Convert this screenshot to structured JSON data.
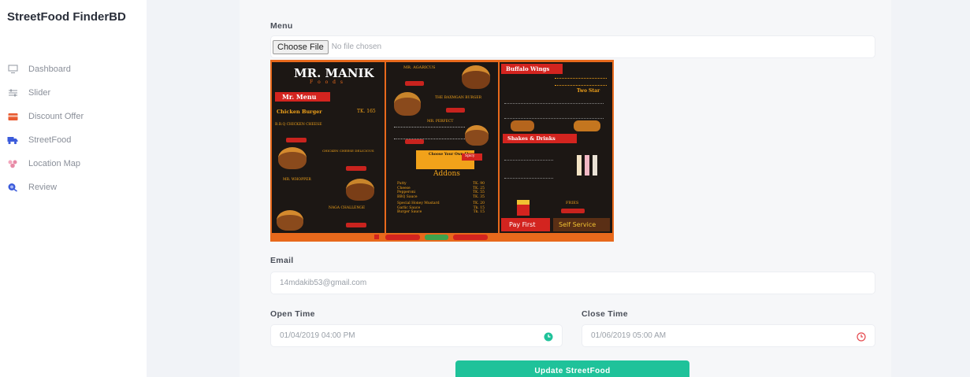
{
  "sidebar": {
    "brand": "StreetFood FinderBD",
    "items": [
      {
        "label": "Dashboard",
        "icon": "monitor-icon",
        "color": "#9aa0a8"
      },
      {
        "label": "Slider",
        "icon": "sliders-icon",
        "color": "#9aa0a8"
      },
      {
        "label": "Discount Offer",
        "icon": "card-icon",
        "color": "#e85a30"
      },
      {
        "label": "StreetFood",
        "icon": "truck-icon",
        "color": "#3b5bdb"
      },
      {
        "label": "Location Map",
        "icon": "map-pins-icon",
        "color": "#e88aa6"
      },
      {
        "label": "Review",
        "icon": "review-icon",
        "color": "#3b5bdb"
      }
    ]
  },
  "form": {
    "menu_label": "Menu",
    "choose_file": "Choose File",
    "no_file": "No file chosen",
    "email_label": "Email",
    "email_value": "14mdakib53@gmail.com",
    "open_time_label": "Open Time",
    "open_time_value": "01/04/2019 04:00 PM",
    "close_time_label": "Close Time",
    "close_time_value": "01/06/2019 05:00 AM",
    "submit_label": "Update StreetFood"
  },
  "menu_image": {
    "title": "MR. MANIK",
    "subtitle": "F o o d s",
    "menu_ribbon": "Mr. Menu",
    "chicken_burger": "Chicken Burger",
    "chicken_burger_price": "TK. 165",
    "bbq": "B.B.Q CHICKEN CHEESE",
    "mr_whopper": "MR. WHOPPER",
    "naga": "NAGA CHALLENGE",
    "chicken_cheese": "CHICKEN CHEESE DELICIOUS",
    "mr_agaricus": "MR. AGARICUS",
    "baxmgan": "THE BAXMGAN BURGER",
    "mr_perfect": "MR. PERFECT",
    "choose_flavor": "Choose Your Own Flavour",
    "spicy": "Spicy",
    "addons": "Addons",
    "addon_items": [
      "Patty",
      "Cheese",
      "Pepperoni",
      "BBQ Sauce",
      "Special Honey Mustard",
      "Garlic Sauce",
      "Burger Sauce"
    ],
    "addon_prices": [
      "TK. 90",
      "TK. 25",
      "TK. 55",
      "TK. 35",
      "TK. 20",
      "Tk. 15",
      "Tk. 15"
    ],
    "buffalo": "Buffalo Wings",
    "two_star": "Two Star",
    "shakes": "Shakes & Drinks",
    "fries": "FRIES",
    "pay_first": "Pay First",
    "self_service": "Self Service"
  },
  "colors": {
    "accent": "#1fc29a",
    "open_clock": "#1fc29a",
    "close_clock": "#e5484d"
  }
}
